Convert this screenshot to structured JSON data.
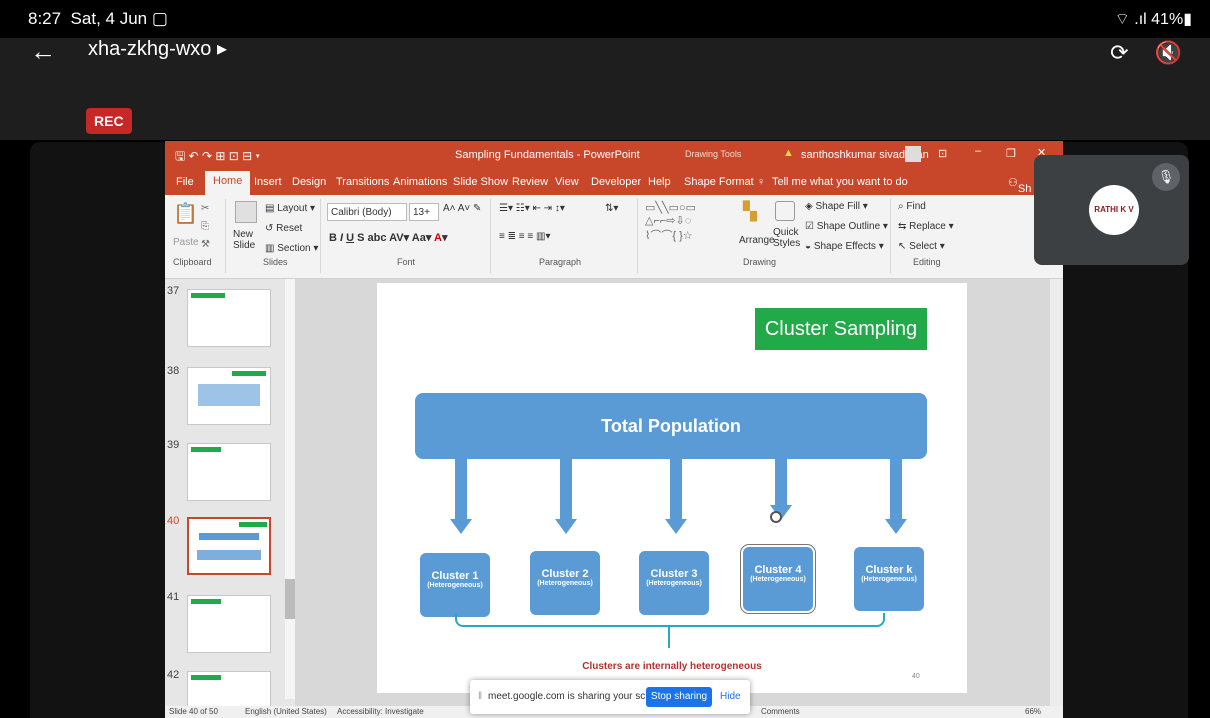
{
  "status": {
    "time": "8:27",
    "date": "Sat, 4 Jun",
    "battery": "41%"
  },
  "meet": {
    "code": "xha-zkhg-wxo",
    "rec": "REC",
    "participant_initials": "RATHI K V"
  },
  "ppt": {
    "title": "Sampling Fundamentals - PowerPoint",
    "drawing_tools": "Drawing Tools",
    "user": "santhoshkumar sivadasan",
    "tabs": [
      "File",
      "Home",
      "Insert",
      "Design",
      "Transitions",
      "Animations",
      "Slide Show",
      "Review",
      "View",
      "Developer",
      "Help",
      "Shape Format"
    ],
    "tell_me": "Tell me what you want to do",
    "share": "Sh",
    "ribbon": {
      "paste": "Paste",
      "new_slide": "New Slide",
      "layout": "Layout",
      "reset": "Reset",
      "section": "Section",
      "font_name": "Calibri (Body)",
      "font_size": "13+",
      "arrange": "Arrange",
      "quick_styles": "Quick Styles",
      "shape_fill": "Shape Fill",
      "shape_outline": "Shape Outline",
      "shape_effects": "Shape Effects",
      "find": "Find",
      "replace": "Replace",
      "select": "Select",
      "groups": [
        "Clipboard",
        "Slides",
        "Font",
        "Paragraph",
        "Drawing",
        "Editing"
      ]
    },
    "thumbs": [
      "37",
      "38",
      "39",
      "40",
      "41",
      "42"
    ],
    "statusbar": {
      "slide": "Slide 40 of 50",
      "lang": "English (United States)",
      "access": "Accessibility: Investigate",
      "comments": "Comments",
      "zoom": "66%"
    }
  },
  "slide": {
    "title": "Cluster Sampling",
    "top": "Total Population",
    "clusters": [
      {
        "n": "Cluster 1",
        "h": "(Heterogeneous)"
      },
      {
        "n": "Cluster 2",
        "h": "(Heterogeneous)"
      },
      {
        "n": "Cluster 3",
        "h": "(Heterogeneous)"
      },
      {
        "n": "Cluster 4",
        "h": "(Heterogeneous)"
      },
      {
        "n": "Cluster k",
        "h": "(Heterogeneous)"
      }
    ],
    "note": "Clusters are internally heterogeneous",
    "num": "40"
  },
  "share_banner": {
    "text": "meet.google.com is sharing your screen.",
    "stop": "Stop sharing",
    "hide": "Hide"
  }
}
